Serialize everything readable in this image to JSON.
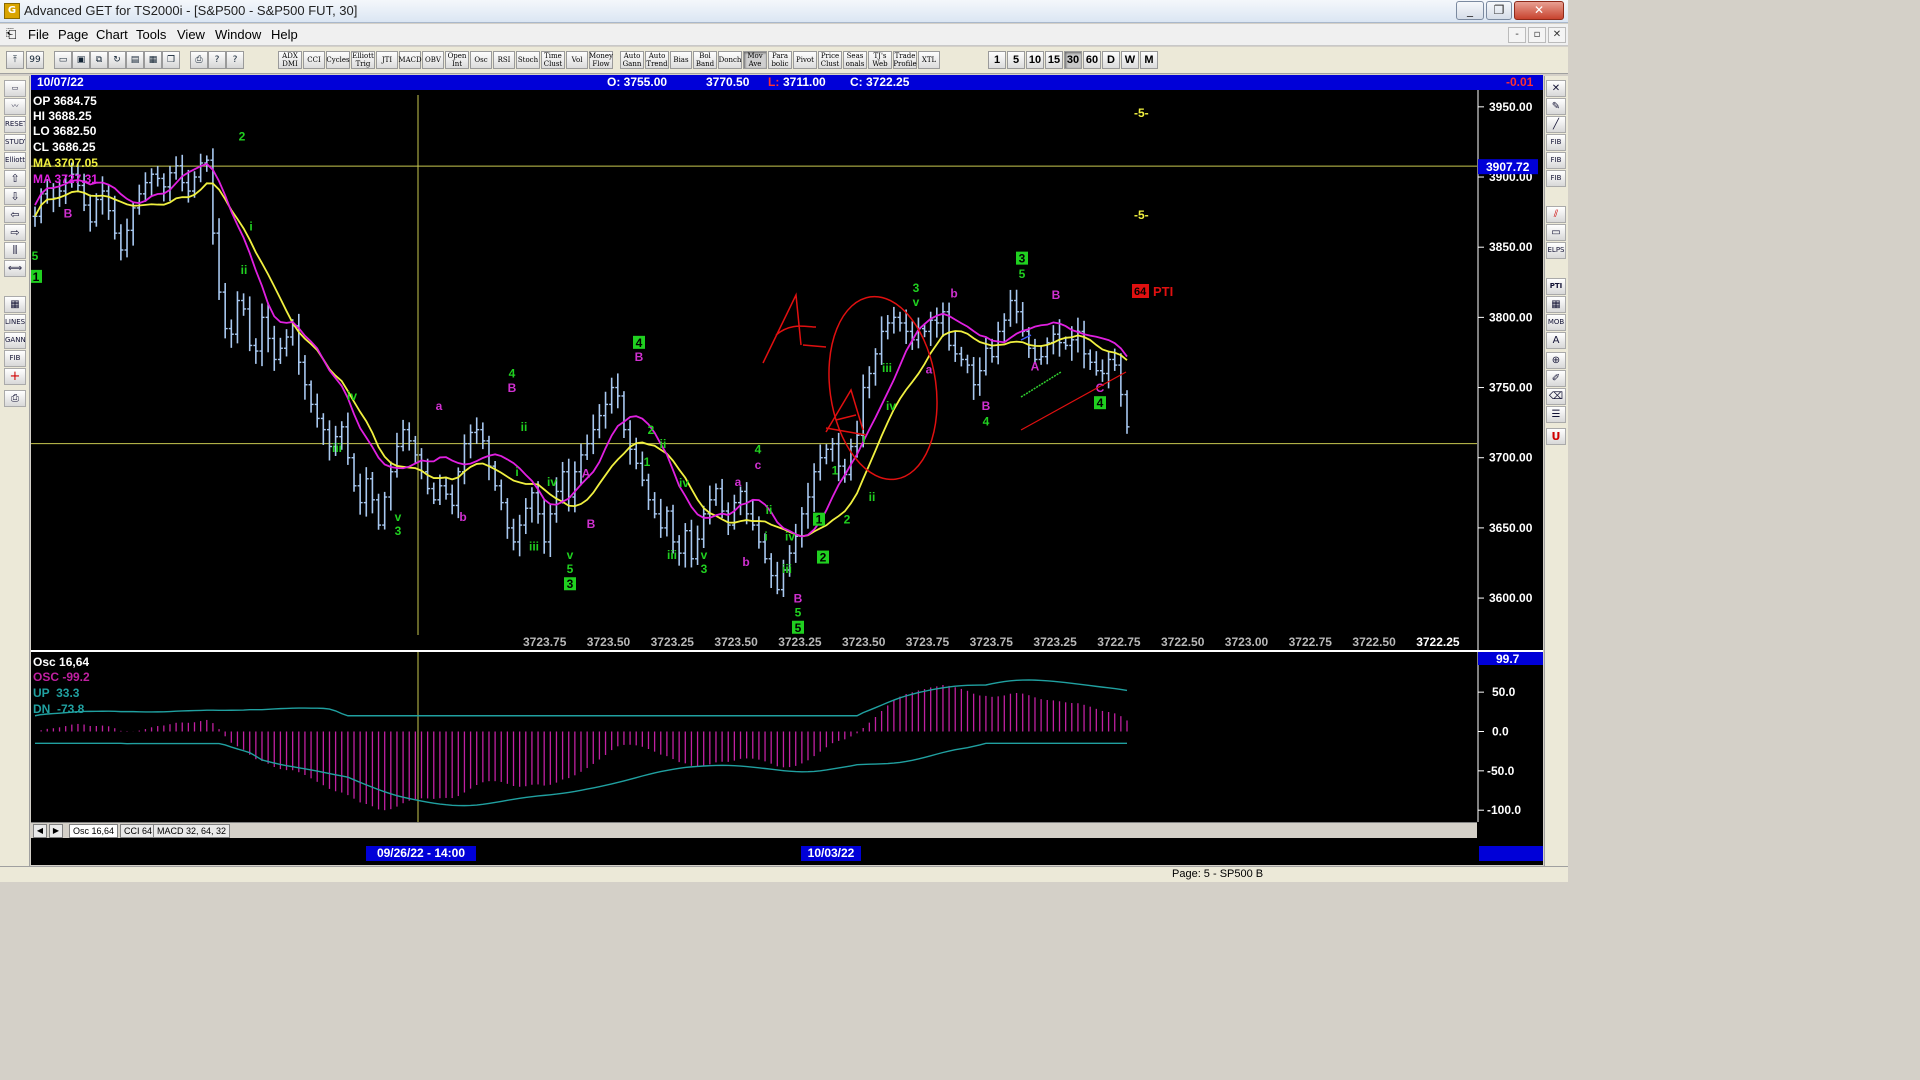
{
  "window": {
    "title": "Advanced GET for TS2000i - [S&P500 - S&P500 FUT, 30]",
    "app_icon": "advanced-get-icon",
    "controls": [
      "_",
      "❐",
      "✕"
    ]
  },
  "menu": {
    "items": [
      "File",
      "Page",
      "Chart",
      "Tools",
      "View",
      "Window",
      "Help"
    ],
    "mdi_controls": [
      "-",
      "▫",
      "✕"
    ]
  },
  "toolbar": {
    "studies": [
      {
        "label": "ADX DMI"
      },
      {
        "label": "CCI"
      },
      {
        "label": "Cycles"
      },
      {
        "label": "Elliott Trig"
      },
      {
        "label": "JTI"
      },
      {
        "label": "MACD"
      },
      {
        "label": "OBV"
      },
      {
        "label": "Open Int"
      },
      {
        "label": "Osc"
      },
      {
        "label": "RSI"
      },
      {
        "label": "Stoch"
      },
      {
        "label": "Time Clust"
      },
      {
        "label": "Vol"
      },
      {
        "label": "Money Flow"
      },
      {
        "label": "Auto Gann"
      },
      {
        "label": "Auto Trend"
      },
      {
        "label": "Bias"
      },
      {
        "label": "Bol Band"
      },
      {
        "label": "Donch"
      },
      {
        "label": "Mov Ave"
      },
      {
        "label": "Para bolic"
      },
      {
        "label": "Pivot"
      },
      {
        "label": "Price Clust"
      },
      {
        "label": "Seas onals"
      },
      {
        "label": "TJ's Web"
      },
      {
        "label": "Trade Profile"
      },
      {
        "label": "XTL"
      }
    ],
    "timeframes": [
      "1",
      "5",
      "10",
      "15",
      "30",
      "60",
      "D",
      "W",
      "M"
    ],
    "active_timeframe": "30"
  },
  "left_tools": [
    "page-icon",
    "wave-icon",
    "reset-icon",
    "study-icon",
    "elliott-icon",
    "up-arrow-icon",
    "down-arrow-icon",
    "left-arrow-icon",
    "right-arrow-icon",
    "bars-icon",
    "zoom-icon",
    "grid-icon",
    "lines-icon",
    "gann-icon",
    "fib-icon",
    "cross-icon",
    "print-icon"
  ],
  "left_tool_labels": {
    "reset": "RESET",
    "study": "STUDY",
    "elliott": "Elliott",
    "lines": "LINES",
    "gann": "GANN",
    "fib": "FIB"
  },
  "right_tools": [
    "close-icon",
    "pencil-icon",
    "line-icon",
    "fib-ret-icon",
    "fib-ext-icon",
    "fib-time-icon",
    "channel-icon",
    "rect-icon",
    "ellipse-icon",
    "pti-icon",
    "grid-icon",
    "mob-icon",
    "text-icon",
    "zoom-icon",
    "paint-icon",
    "eraser-icon",
    "list-icon",
    "u-icon"
  ],
  "right_tool_labels": {
    "fib_ret": "FIB RET",
    "fib_ext": "FIB EXT",
    "fib_time": "FIB TIME",
    "elps": "ELPS",
    "pti": "PTI",
    "mob": "MOB",
    "u": "U"
  },
  "infobar": {
    "date": "10/07/22",
    "open": "O: 3755.00",
    "high": "3770.50",
    "low_label": "L:",
    "low": "3711.00",
    "close": "C: 3722.25",
    "change": "-0.01"
  },
  "stats": {
    "op": "OP 3684.75",
    "hi": "HI 3688.25",
    "lo": "LO 3682.50",
    "cl": "CL 3686.25",
    "ma1": "MA 3707.05",
    "ma2": "MA 3727.31"
  },
  "price_axis": {
    "ticks": [
      "3950.00",
      "3900.00",
      "3850.00",
      "3800.00",
      "3750.00",
      "3700.00",
      "3650.00",
      "3600.00"
    ],
    "tick_values": [
      3950,
      3900,
      3850,
      3800,
      3750,
      3700,
      3650,
      3600
    ],
    "highlight": "3907.72",
    "highlight_value": 3907.72
  },
  "price_scale": {
    "top": 3962,
    "bottom": 3563
  },
  "bottom_values": [
    "3723.75",
    "3723.50",
    "3723.25",
    "3723.50",
    "3723.25",
    "3723.50",
    "3723.75",
    "3723.75",
    "3723.25",
    "3722.75",
    "3722.50",
    "3723.00",
    "3722.75",
    "3722.50",
    "3722.25"
  ],
  "chart_annotations": {
    "pti_value": "64",
    "pti_label": "PTI",
    "marker_5": "-5-",
    "horizontal_lines": [
      3907.72,
      3710.0
    ]
  },
  "colors": {
    "bars": "#a8c8f0",
    "ma_yellow": "#f0f040",
    "ma_magenta": "#e020e0",
    "wave_green": "#20d020",
    "wave_magenta": "#d030d0",
    "annotation_red": "#e01010",
    "osc_histogram": "#c020a0",
    "osc_up": "#20a0a0"
  },
  "waves": [
    {
      "t": "2",
      "x": 242,
      "p": 3926,
      "c": "g"
    },
    {
      "t": "B",
      "x": 68,
      "p": 3871,
      "c": "m"
    },
    {
      "t": "5",
      "x": 35,
      "p": 3841,
      "c": "g"
    },
    {
      "t": "1",
      "x": 36,
      "p": 3826,
      "c": "gb"
    },
    {
      "t": "i",
      "x": 251,
      "p": 3862,
      "c": "g"
    },
    {
      "t": "ii",
      "x": 244,
      "p": 3831,
      "c": "g"
    },
    {
      "t": "iii",
      "x": 337,
      "p": 3704,
      "c": "g"
    },
    {
      "t": "iv",
      "x": 352,
      "p": 3741,
      "c": "g"
    },
    {
      "t": "v",
      "x": 398,
      "p": 3655,
      "c": "g"
    },
    {
      "t": "3",
      "x": 398,
      "p": 3645,
      "c": "g"
    },
    {
      "t": "a",
      "x": 439,
      "p": 3734,
      "c": "m"
    },
    {
      "t": "b",
      "x": 463,
      "p": 3655,
      "c": "m"
    },
    {
      "t": "4",
      "x": 512,
      "p": 3757,
      "c": "g"
    },
    {
      "t": "B",
      "x": 512,
      "p": 3747,
      "c": "m"
    },
    {
      "t": "ii",
      "x": 524,
      "p": 3719,
      "c": "g"
    },
    {
      "t": "i",
      "x": 517,
      "p": 3687,
      "c": "g"
    },
    {
      "t": "iv",
      "x": 552,
      "p": 3680,
      "c": "g"
    },
    {
      "t": "iii",
      "x": 534,
      "p": 3634,
      "c": "g"
    },
    {
      "t": "v",
      "x": 570,
      "p": 3628,
      "c": "g"
    },
    {
      "t": "5",
      "x": 570,
      "p": 3618,
      "c": "g"
    },
    {
      "t": "3",
      "x": 570,
      "p": 3607,
      "c": "gb"
    },
    {
      "t": "A",
      "x": 586,
      "p": 3686,
      "c": "m"
    },
    {
      "t": "B",
      "x": 591,
      "p": 3650,
      "c": "m"
    },
    {
      "t": "4",
      "x": 639,
      "p": 3779,
      "c": "gb"
    },
    {
      "t": "B",
      "x": 639,
      "p": 3769,
      "c": "m"
    },
    {
      "t": "2",
      "x": 651,
      "p": 3717,
      "c": "g"
    },
    {
      "t": "ii",
      "x": 663,
      "p": 3707,
      "c": "g"
    },
    {
      "t": "1",
      "x": 647,
      "p": 3694,
      "c": "g"
    },
    {
      "t": "iv",
      "x": 684,
      "p": 3679,
      "c": "g"
    },
    {
      "t": "iii",
      "x": 672,
      "p": 3628,
      "c": "g"
    },
    {
      "t": "v",
      "x": 704,
      "p": 3628,
      "c": "g"
    },
    {
      "t": "3",
      "x": 704,
      "p": 3618,
      "c": "g"
    },
    {
      "t": "a",
      "x": 738,
      "p": 3680,
      "c": "m"
    },
    {
      "t": "b",
      "x": 746,
      "p": 3623,
      "c": "m"
    },
    {
      "t": "4",
      "x": 758,
      "p": 3703,
      "c": "g"
    },
    {
      "t": "c",
      "x": 758,
      "p": 3692,
      "c": "m"
    },
    {
      "t": "ii",
      "x": 769,
      "p": 3660,
      "c": "g"
    },
    {
      "t": "i",
      "x": 766,
      "p": 3641,
      "c": "g"
    },
    {
      "t": "iv",
      "x": 790,
      "p": 3641,
      "c": "g"
    },
    {
      "t": "iii",
      "x": 787,
      "p": 3618,
      "c": "g"
    },
    {
      "t": "B",
      "x": 798,
      "p": 3597,
      "c": "m"
    },
    {
      "t": "5",
      "x": 798,
      "p": 3587,
      "c": "g"
    },
    {
      "t": "5",
      "x": 798,
      "p": 3576,
      "c": "gb"
    },
    {
      "t": "1",
      "x": 835,
      "p": 3688,
      "c": "g"
    },
    {
      "t": "2",
      "x": 847,
      "p": 3653,
      "c": "g"
    },
    {
      "t": "1",
      "x": 819,
      "p": 3653,
      "c": "gb"
    },
    {
      "t": "2",
      "x": 823,
      "p": 3626,
      "c": "gb"
    },
    {
      "t": "i",
      "x": 864,
      "p": 3711,
      "c": "g"
    },
    {
      "t": "ii",
      "x": 872,
      "p": 3669,
      "c": "g"
    },
    {
      "t": "iii",
      "x": 887,
      "p": 3761,
      "c": "g"
    },
    {
      "t": "iv",
      "x": 891,
      "p": 3734,
      "c": "g"
    },
    {
      "t": "3",
      "x": 916,
      "p": 3818,
      "c": "g"
    },
    {
      "t": "v",
      "x": 916,
      "p": 3808,
      "c": "g"
    },
    {
      "t": "a",
      "x": 929,
      "p": 3760,
      "c": "m"
    },
    {
      "t": "b",
      "x": 954,
      "p": 3814,
      "c": "m"
    },
    {
      "t": "B",
      "x": 986,
      "p": 3734,
      "c": "m"
    },
    {
      "t": "4",
      "x": 986,
      "p": 3723,
      "c": "g"
    },
    {
      "t": "3",
      "x": 1022,
      "p": 3839,
      "c": "gb"
    },
    {
      "t": "5",
      "x": 1022,
      "p": 3828,
      "c": "g"
    },
    {
      "t": "A",
      "x": 1035,
      "p": 3762,
      "c": "m"
    },
    {
      "t": "B",
      "x": 1056,
      "p": 3813,
      "c": "m"
    },
    {
      "t": "C",
      "x": 1100,
      "p": 3747,
      "c": "m"
    },
    {
      "t": "4",
      "x": 1100,
      "p": 3736,
      "c": "gb"
    }
  ],
  "osc": {
    "title": "Osc 16,64",
    "osc_value": "OSC -99.2",
    "up_value": "UP  33.3",
    "dn_value": "DN  -73.8",
    "axis_ticks": [
      "50.0",
      "0.0",
      "-50.0",
      "-100.0"
    ],
    "axis_values": [
      50,
      0,
      -50,
      -100
    ],
    "top_value": "99.7",
    "tabs": [
      "Osc 16,64",
      "CCI 64",
      "MACD 32, 64, 32"
    ],
    "active_tab": "Osc 16,64"
  },
  "osc_scale": {
    "top": 101,
    "bottom": -115
  },
  "time_axis": {
    "labels": [
      "09/26/22 - 14:00",
      "10/03/22"
    ]
  },
  "status": {
    "page": "Page: 5 - SP500 B"
  },
  "chart_data": {
    "type": "bar",
    "title": "",
    "x": "bar index (30-minute bars)",
    "ylim": [
      3563,
      3962
    ],
    "closes": [
      3872,
      3888,
      3892,
      3885,
      3890,
      3896,
      3902,
      3894,
      3880,
      3868,
      3884,
      3890,
      3876,
      3860,
      3848,
      3862,
      3878,
      3888,
      3896,
      3902,
      3899,
      3893,
      3903,
      3908,
      3896,
      3890,
      3900,
      3910,
      3912,
      3860,
      3818,
      3792,
      3788,
      3812,
      3806,
      3780,
      3776,
      3800,
      3785,
      3770,
      3778,
      3786,
      3794,
      3768,
      3752,
      3738,
      3728,
      3720,
      3708,
      3715,
      3722,
      3700,
      3680,
      3668,
      3685,
      3670,
      3652,
      3672,
      3690,
      3708,
      3720,
      3712,
      3702,
      3690,
      3678,
      3670,
      3680,
      3674,
      3666,
      3690,
      3710,
      3718,
      3720,
      3712,
      3694,
      3680,
      3668,
      3650,
      3640,
      3652,
      3664,
      3675,
      3660,
      3640,
      3660,
      3676,
      3690,
      3672,
      3690,
      3702,
      3710,
      3720,
      3730,
      3738,
      3750,
      3744,
      3720,
      3706,
      3696,
      3684,
      3670,
      3660,
      3650,
      3662,
      3640,
      3632,
      3648,
      3628,
      3642,
      3660,
      3670,
      3678,
      3662,
      3652,
      3668,
      3676,
      3660,
      3652,
      3640,
      3628,
      3616,
      3606,
      3620,
      3632,
      3644,
      3660,
      3672,
      3690,
      3700,
      3706,
      3710,
      3694,
      3688,
      3708,
      3716,
      3750,
      3760,
      3774,
      3790,
      3796,
      3800,
      3796,
      3790,
      3784,
      3792,
      3790,
      3798,
      3796,
      3804,
      3780,
      3774,
      3770,
      3766,
      3752,
      3762,
      3778,
      3772,
      3790,
      3798,
      3812,
      3804,
      3790,
      3778,
      3770,
      3772,
      3782,
      3788,
      3782,
      3780,
      3784,
      3790,
      3774,
      3768,
      3762,
      3760,
      3770,
      3766,
      3745,
      3722
    ]
  }
}
